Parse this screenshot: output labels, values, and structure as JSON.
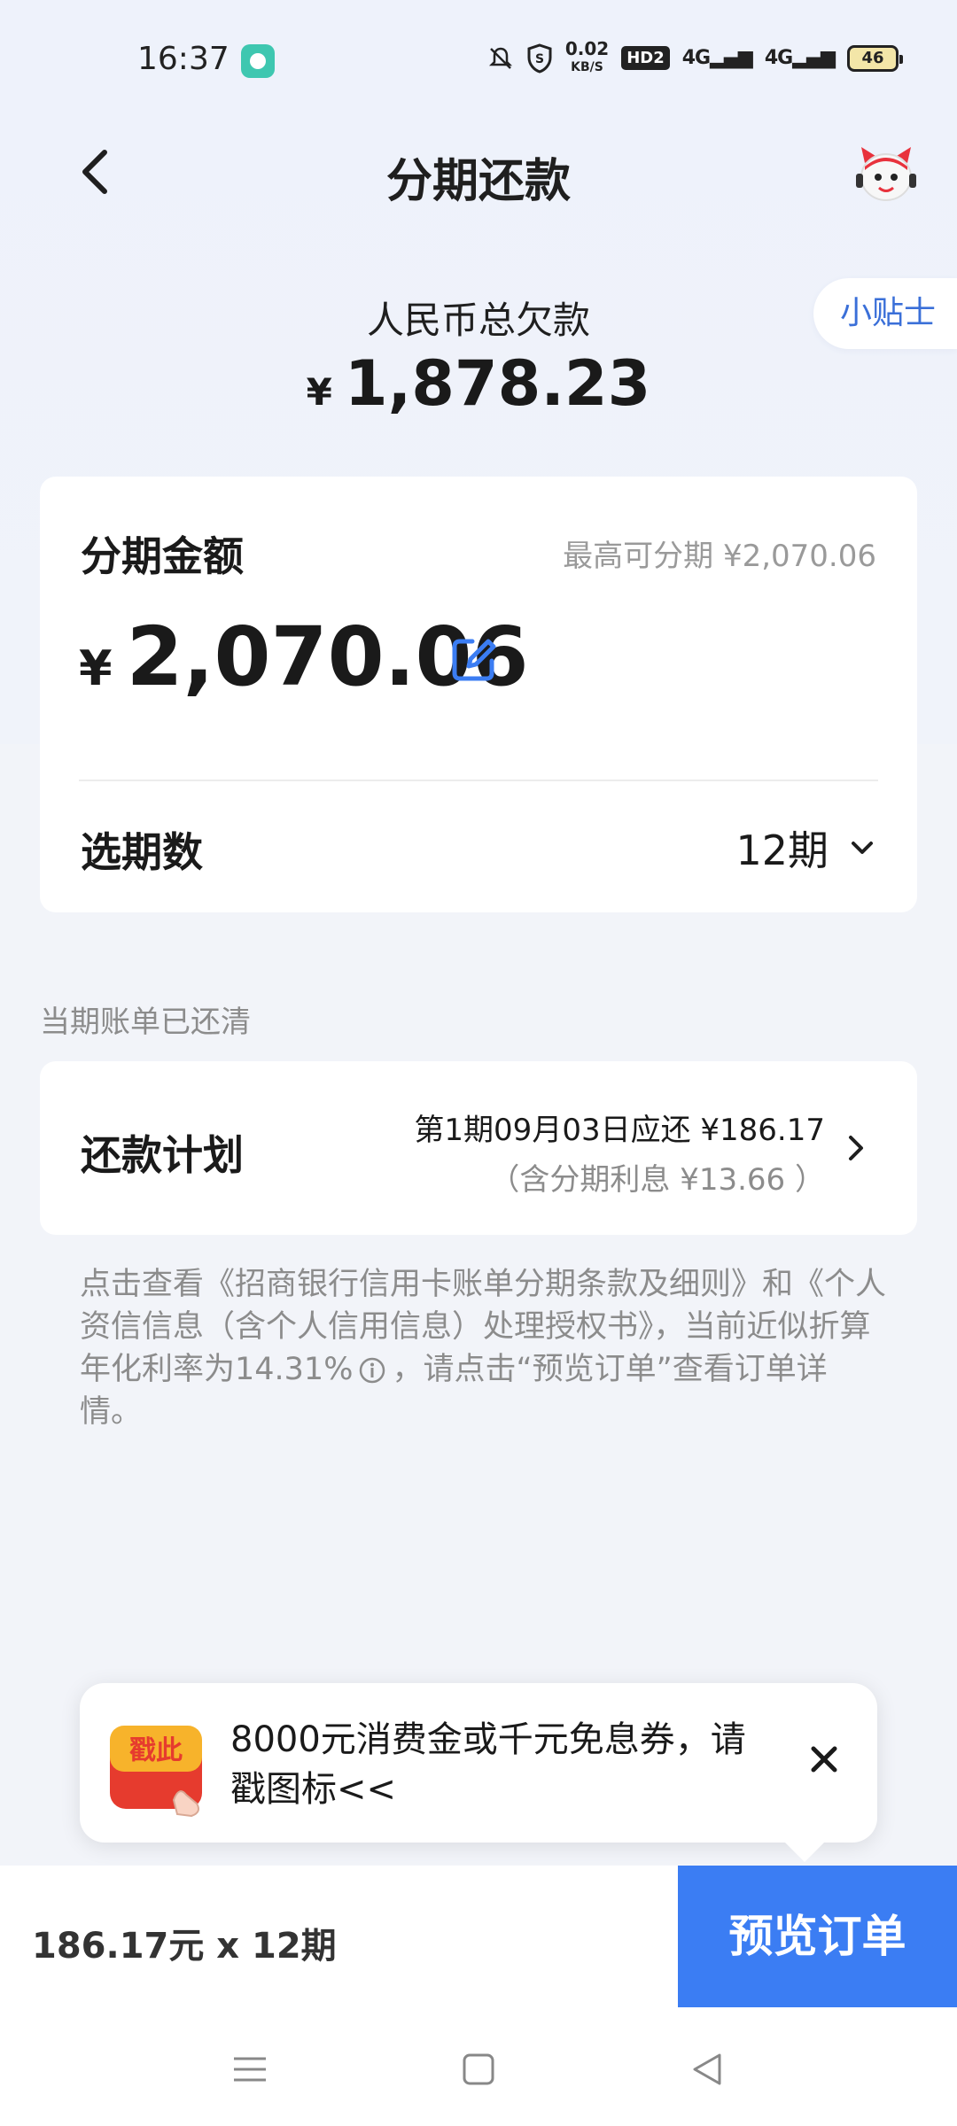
{
  "status_bar": {
    "time": "16:37",
    "speed_value": "0.02",
    "speed_unit": "KB/S",
    "hd": "HD2",
    "sig1": "4G",
    "sig2": "4G",
    "battery": "46"
  },
  "header": {
    "title": "分期还款"
  },
  "tips": {
    "label": "小贴士"
  },
  "debt": {
    "label": "人民币总欠款",
    "currency": "¥",
    "amount": "1,878.23"
  },
  "installment": {
    "title": "分期金额",
    "max_label": "最高可分期 ¥2,070.06",
    "currency": "¥",
    "amount": "2,070.06",
    "period_label": "选期数",
    "period_value": "12期"
  },
  "bill_status": "当期账单已还清",
  "plan": {
    "title": "还款计划",
    "line1": "第1期09月03日应还 ¥186.17",
    "line2": "（含分期利息 ¥13.66 ）"
  },
  "notice": {
    "part1": "点击查看《招商银行信用卡账单分期条款及细则》和《个人资信信息（含个人信用信息）处理授权书》，当前近似折算年化利率为14.31%",
    "part2": "，请点击“预览订单”查看订单详情。"
  },
  "promo": {
    "badge_text": "戳此",
    "text": "8000元消费金或千元免息券，请戳图标<<"
  },
  "bottom": {
    "summary": "186.17元 x 12期",
    "button": "预览订单"
  },
  "colors": {
    "accent": "#3b7df3",
    "link": "#3a6fd8",
    "background": "#f2f4f9"
  }
}
